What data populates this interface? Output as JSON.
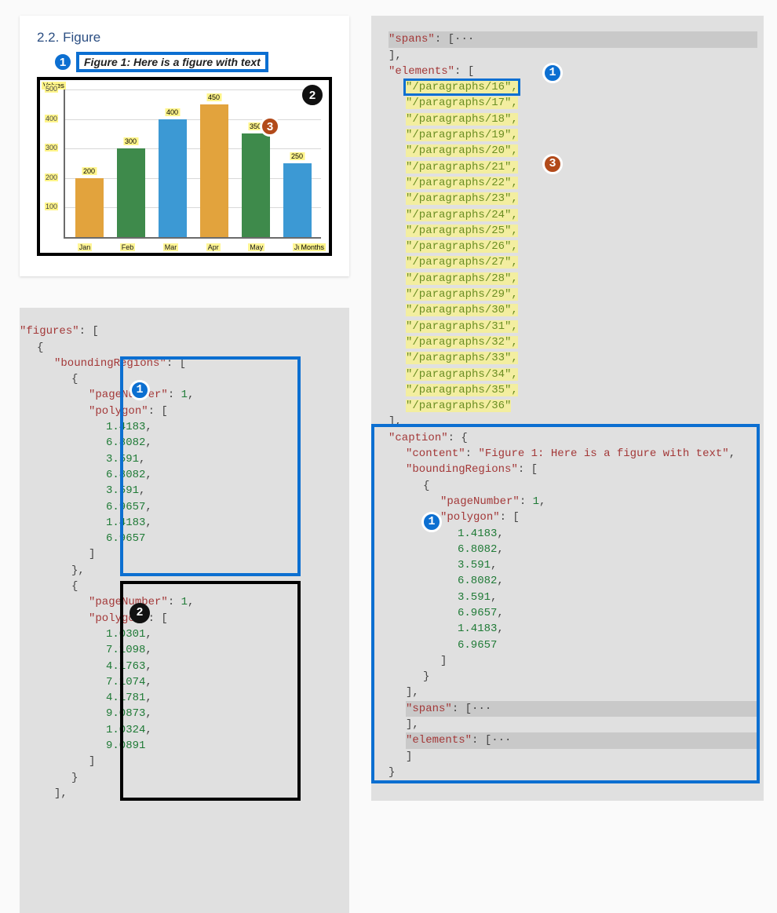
{
  "doc": {
    "heading": "2.2. Figure",
    "caption": "Figure 1: Here is a figure with text"
  },
  "badges": {
    "b1": "1",
    "b2": "2",
    "b3": "3"
  },
  "chart_data": {
    "type": "bar",
    "categories": [
      "Jan",
      "Feb",
      "Mar",
      "Apr",
      "May",
      "Jun"
    ],
    "values": [
      200,
      300,
      400,
      450,
      350,
      250
    ],
    "colors": [
      "orange",
      "green",
      "blue",
      "orange",
      "green",
      "blue"
    ],
    "title": "",
    "xlabel": "Months",
    "ylabel": "Values",
    "y_ticks": [
      100,
      200,
      300,
      400,
      500
    ],
    "ylim": [
      0,
      500
    ]
  },
  "left_json": {
    "root_key": "figures",
    "regions_key": "boundingRegions",
    "region1": {
      "pageNumber_key": "pageNumber",
      "pageNumber": "1",
      "polygon_key": "polygon",
      "polygon": [
        "1.4183",
        "6.8082",
        "3.591",
        "6.8082",
        "3.591",
        "6.9657",
        "1.4183",
        "6.9657"
      ]
    },
    "region2": {
      "pageNumber_key": "pageNumber",
      "pageNumber": "1",
      "polygon_key": "polygon",
      "polygon": [
        "1.0301",
        "7.1098",
        "4.1763",
        "7.1074",
        "4.1781",
        "9.0873",
        "1.0324",
        "9.0891"
      ]
    }
  },
  "right_json": {
    "spans_key": "spans",
    "elements_key": "elements",
    "first_element": "\"/paragraphs/16\",",
    "elements_rest": [
      "\"/paragraphs/17\",",
      "\"/paragraphs/18\",",
      "\"/paragraphs/19\",",
      "\"/paragraphs/20\",",
      "\"/paragraphs/21\",",
      "\"/paragraphs/22\",",
      "\"/paragraphs/23\",",
      "\"/paragraphs/24\",",
      "\"/paragraphs/25\",",
      "\"/paragraphs/26\",",
      "\"/paragraphs/27\",",
      "\"/paragraphs/28\",",
      "\"/paragraphs/29\",",
      "\"/paragraphs/30\",",
      "\"/paragraphs/31\",",
      "\"/paragraphs/32\",",
      "\"/paragraphs/33\",",
      "\"/paragraphs/34\",",
      "\"/paragraphs/35\",",
      "\"/paragraphs/36\""
    ],
    "caption_key": "caption",
    "content_key": "content",
    "content_val": "\"Figure 1: Here is a figure with text\"",
    "boundingRegions_key": "boundingRegions",
    "pageNumber_key": "pageNumber",
    "pageNumber": "1",
    "polygon_key": "polygon",
    "polygon": [
      "1.4183",
      "6.8082",
      "3.591",
      "6.8082",
      "3.591",
      "6.9657",
      "1.4183",
      "6.9657"
    ],
    "r_spans_key": "spans",
    "r_elements_key": "elements",
    "ellipsis": "···"
  }
}
